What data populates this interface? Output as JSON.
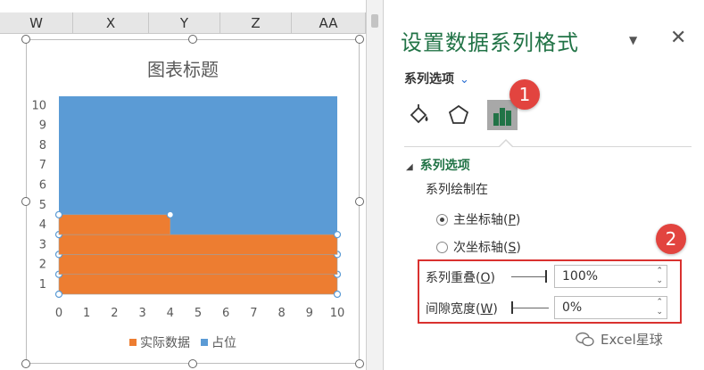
{
  "sheet": {
    "columns": [
      "W",
      "X",
      "Y",
      "Z",
      "AA"
    ]
  },
  "chart_data": {
    "type": "bar",
    "title": "图表标题",
    "orientation": "horizontal",
    "x_ticks": [
      0,
      1,
      2,
      3,
      4,
      5,
      6,
      7,
      8,
      9,
      10
    ],
    "y_ticks": [
      1,
      2,
      3,
      4,
      5,
      6,
      7,
      8,
      9,
      10
    ],
    "xlim": [
      0,
      10
    ],
    "ylim": [
      0,
      10
    ],
    "series": [
      {
        "name": "实际数据",
        "color": "#ed7d31",
        "values": [
          10,
          10,
          10,
          4
        ]
      },
      {
        "name": "占位",
        "color": "#5b9bd5",
        "values": [
          10
        ]
      }
    ],
    "series_overlap": "100%",
    "gap_width": "0%",
    "grid": false,
    "legend_position": "bottom"
  },
  "pane": {
    "title": "设置数据系列格式",
    "series_options_label": "系列选项",
    "section_title": "系列选项",
    "plot_on_label": "系列绘制在",
    "primary_axis_label": "主坐标轴(",
    "primary_axis_key": "P",
    "primary_axis_end": ")",
    "secondary_axis_label": "次坐标轴(",
    "secondary_axis_key": "S",
    "secondary_axis_end": ")",
    "overlap_label": "系列重叠(",
    "overlap_key": "O",
    "overlap_end": ")",
    "overlap_value": "100%",
    "gap_label": "间隙宽度(",
    "gap_key": "W",
    "gap_end": ")",
    "gap_value": "0%",
    "accent_color": "#217346"
  },
  "annotations": {
    "badge1": "1",
    "badge2": "2"
  },
  "watermark": "Excel星球"
}
